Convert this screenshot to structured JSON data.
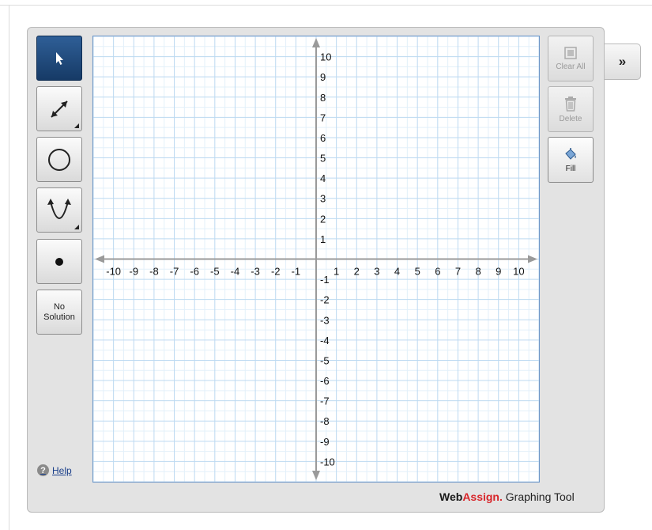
{
  "tools": {
    "select": {
      "icon": "arrow-cursor-icon",
      "selected": true
    },
    "line": {
      "icon": "line-segment-icon"
    },
    "circle": {
      "icon": "circle-icon"
    },
    "parabola": {
      "icon": "parabola-icon"
    },
    "point": {
      "icon": "point-icon"
    },
    "no_solution": {
      "line1": "No",
      "line2": "Solution"
    }
  },
  "actions": {
    "clear_all": {
      "label": "Clear All",
      "icon": "clear-all-icon",
      "enabled": false
    },
    "delete": {
      "label": "Delete",
      "icon": "trash-icon",
      "enabled": false
    },
    "fill": {
      "label": "Fill",
      "icon": "paint-bucket-icon",
      "enabled": true
    }
  },
  "expand": {
    "label": "»"
  },
  "help": {
    "label": "Help"
  },
  "branding": {
    "part1": "Web",
    "part2": "Assign.",
    "part3": " Graphing Tool"
  },
  "graph": {
    "x_tick_labels": [
      "-10",
      "-9",
      "-8",
      "-7",
      "-6",
      "-5",
      "-4",
      "-3",
      "-2",
      "-1",
      "1",
      "2",
      "3",
      "4",
      "5",
      "6",
      "7",
      "8",
      "9",
      "10"
    ],
    "y_tick_labels": [
      "10",
      "9",
      "8",
      "7",
      "6",
      "5",
      "4",
      "3",
      "2",
      "1",
      "-1",
      "-2",
      "-3",
      "-4",
      "-5",
      "-6",
      "-7",
      "-8",
      "-9",
      "-10"
    ],
    "x_range": [
      -11,
      11
    ],
    "y_range": [
      -11,
      11
    ],
    "minor_grid_step": 0.5,
    "grid": true,
    "colors": {
      "major_grid": "#bcd9f1",
      "minor_grid": "#e3f0fa",
      "axes": "#9a9a9a",
      "selected_tool": "#1f4a80",
      "brand_accent": "#d8262b"
    }
  }
}
